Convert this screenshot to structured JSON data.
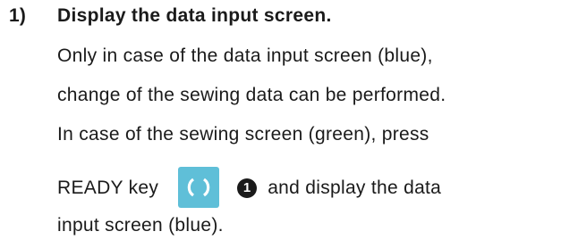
{
  "step": {
    "number": "1)",
    "heading": "Display the data input screen.",
    "lines": [
      "Only in case of the data input screen (blue),",
      "change of the sewing data can be performed.",
      "In case of the sewing screen (green), press"
    ],
    "ready_line": {
      "before": "READY key",
      "callout": "1",
      "after": "and display the data"
    },
    "last_line": "input screen (blue).",
    "ready_key_icon": "ready-key-icon",
    "ready_key_color": "#5fbfd8"
  }
}
